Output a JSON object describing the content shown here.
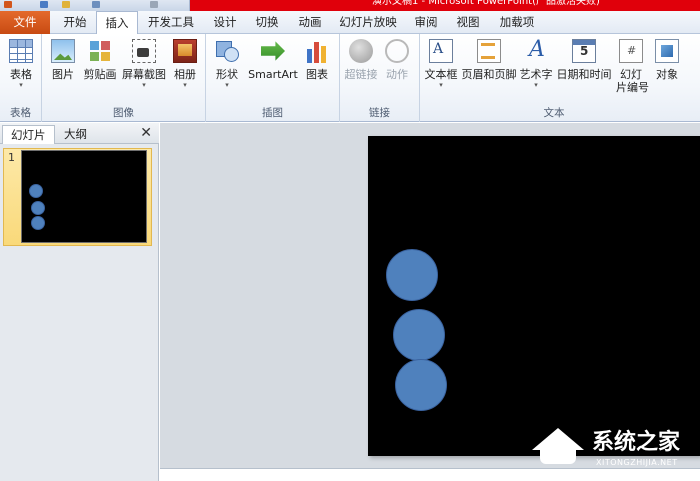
{
  "window": {
    "title": "演示文稿1 - Microsoft PowerPoint(产品激活失败)"
  },
  "ribbon_tabs": [
    {
      "label": "文件",
      "active": false
    },
    {
      "label": "开始",
      "active": false
    },
    {
      "label": "插入",
      "active": true
    },
    {
      "label": "开发工具",
      "active": false
    },
    {
      "label": "设计",
      "active": false
    },
    {
      "label": "切换",
      "active": false
    },
    {
      "label": "动画",
      "active": false
    },
    {
      "label": "幻灯片放映",
      "active": false
    },
    {
      "label": "审阅",
      "active": false
    },
    {
      "label": "视图",
      "active": false
    },
    {
      "label": "加载项",
      "active": false
    }
  ],
  "groups": {
    "tables": {
      "label": "表格",
      "buttons": {
        "table": "表格"
      }
    },
    "images": {
      "label": "图像",
      "buttons": {
        "picture": "图片",
        "clipart": "剪贴画",
        "screenshot": "屏幕截图",
        "album": "相册"
      }
    },
    "illustrations": {
      "label": "插图",
      "buttons": {
        "shapes": "形状",
        "smartart": "SmartArt",
        "chart": "图表"
      }
    },
    "links": {
      "label": "链接",
      "buttons": {
        "hyperlink": "超链接",
        "action": "动作"
      }
    },
    "text": {
      "label": "文本",
      "buttons": {
        "textbox": "文本框",
        "header_footer": "页眉和页脚",
        "wordart": "艺术字",
        "date_time": "日期和时间",
        "slide_number_line1": "幻灯",
        "slide_number_line2": "片编号",
        "object": "对象"
      }
    }
  },
  "left_pane": {
    "tabs": [
      {
        "label": "幻灯片",
        "active": true
      },
      {
        "label": "大纲",
        "active": false
      }
    ],
    "close_glyph": "✕",
    "slides": [
      {
        "number": "1",
        "selected": true,
        "circles": 3
      }
    ]
  },
  "slide": {
    "background": "#000000",
    "shape_color": "#4f81bd",
    "circles": 3
  },
  "watermark": {
    "text": "系统之家",
    "subtext": "XITONGZHIJIA.NET"
  },
  "colors": {
    "title_bar": "#e0000b",
    "file_tab": "#d2561c",
    "circle_fill": "#4f81bd"
  }
}
